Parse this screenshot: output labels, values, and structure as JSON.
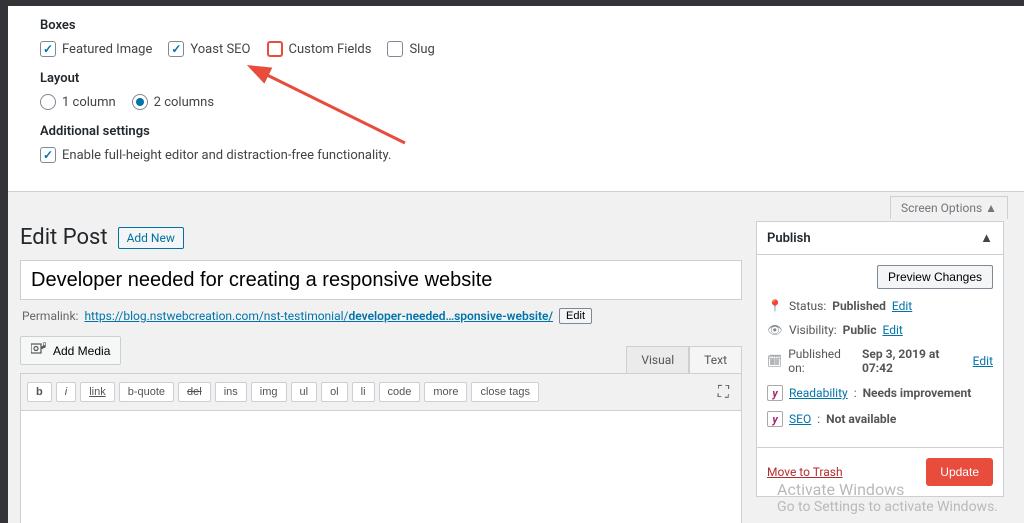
{
  "screenOptions": {
    "boxesTitle": "Boxes",
    "boxes": [
      {
        "label": "Featured Image",
        "checked": true
      },
      {
        "label": "Yoast SEO",
        "checked": true
      },
      {
        "label": "Custom Fields",
        "checked": false
      },
      {
        "label": "Slug",
        "checked": false
      }
    ],
    "layoutTitle": "Layout",
    "layoutOptions": [
      {
        "label": "1 column",
        "checked": false
      },
      {
        "label": "2 columns",
        "checked": true
      }
    ],
    "additionalTitle": "Additional settings",
    "fullHeightLabel": "Enable full-height editor and distraction-free functionality.",
    "fullHeightChecked": true,
    "toggleLabel": "Screen Options ▲"
  },
  "header": {
    "title": "Edit Post",
    "addNew": "Add New"
  },
  "post": {
    "title": "Developer needed for creating a responsive website",
    "permalinkLabel": "Permalink:",
    "permalinkBase": "https://blog.nstwebcreation.com/nst-testimonial/",
    "permalinkSlug": "developer-needed…sponsive-website/",
    "editLabel": "Edit"
  },
  "editor": {
    "addMedia": "Add Media",
    "tabs": {
      "visual": "Visual",
      "text": "Text"
    },
    "qtags": [
      "b",
      "i",
      "link",
      "b-quote",
      "del",
      "ins",
      "img",
      "ul",
      "ol",
      "li",
      "code",
      "more",
      "close tags"
    ]
  },
  "publish": {
    "title": "Publish",
    "preview": "Preview Changes",
    "statusLabel": "Status:",
    "statusValue": "Published",
    "visibilityLabel": "Visibility:",
    "visibilityValue": "Public",
    "publishedOnLabel": "Published on:",
    "publishedOnValue": "Sep 3, 2019 at 07:42",
    "readabilityLabel": "Readability",
    "readabilityValue": "Needs improvement",
    "seoLabel": "SEO",
    "seoValue": "Not available",
    "editLink": "Edit",
    "trash": "Move to Trash",
    "update": "Update"
  },
  "watermark": {
    "line1": "Activate Windows",
    "line2": "Go to Settings to activate Windows."
  }
}
